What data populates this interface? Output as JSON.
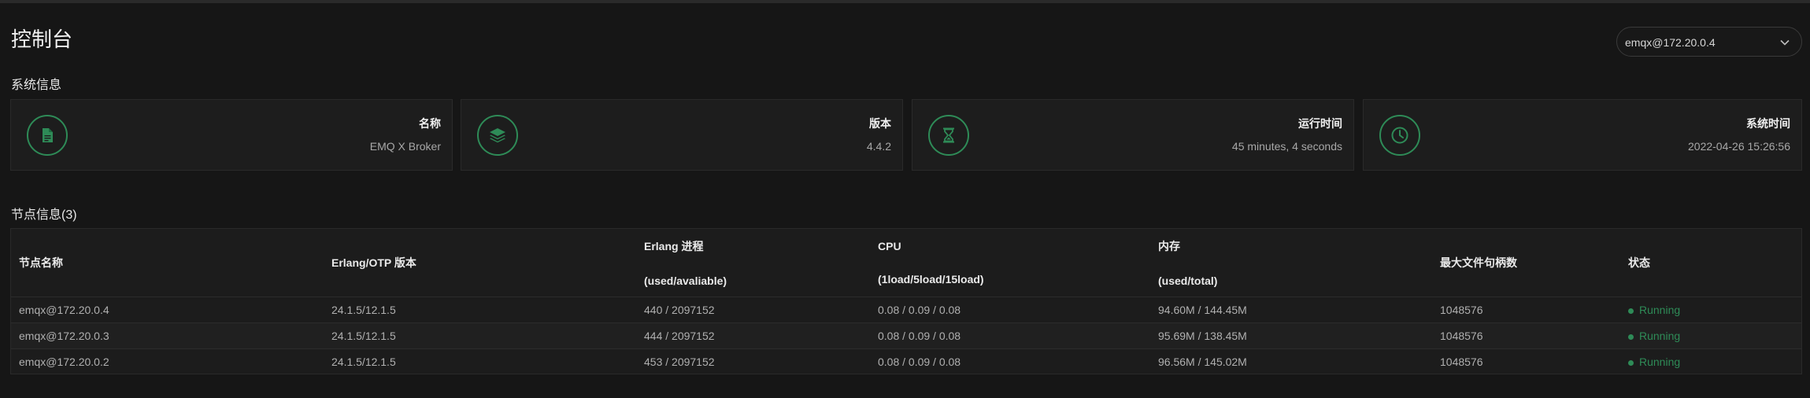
{
  "page": {
    "title": "控制台"
  },
  "node_selector": {
    "value": "emqx@172.20.0.4"
  },
  "system_info": {
    "heading": "系统信息",
    "cards": [
      {
        "label": "名称",
        "value": "EMQ X Broker",
        "icon": "file-icon"
      },
      {
        "label": "版本",
        "value": "4.4.2",
        "icon": "layers-icon"
      },
      {
        "label": "运行时间",
        "value": "45 minutes, 4 seconds",
        "icon": "hourglass-icon"
      },
      {
        "label": "系统时间",
        "value": "2022-04-26 15:26:56",
        "icon": "clock-icon"
      }
    ]
  },
  "nodes": {
    "heading": "节点信息(3)",
    "columns": [
      {
        "line1": "节点名称",
        "line2": ""
      },
      {
        "line1": "Erlang/OTP 版本",
        "line2": ""
      },
      {
        "line1": "Erlang 进程",
        "line2": "(used/avaliable)"
      },
      {
        "line1": "CPU",
        "line2": "(1load/5load/15load)"
      },
      {
        "line1": "内存",
        "line2": "(used/total)"
      },
      {
        "line1": "最大文件句柄数",
        "line2": ""
      },
      {
        "line1": "状态",
        "line2": ""
      }
    ],
    "rows": [
      {
        "name": "emqx@172.20.0.4",
        "otp": "24.1.5/12.1.5",
        "procs": "440 / 2097152",
        "cpu": "0.08 / 0.09 / 0.08",
        "mem": "94.60M / 144.45M",
        "fd": "1048576",
        "status": "Running"
      },
      {
        "name": "emqx@172.20.0.3",
        "otp": "24.1.5/12.1.5",
        "procs": "444 / 2097152",
        "cpu": "0.08 / 0.09 / 0.08",
        "mem": "95.69M / 138.45M",
        "fd": "1048576",
        "status": "Running"
      },
      {
        "name": "emqx@172.20.0.2",
        "otp": "24.1.5/12.1.5",
        "procs": "453 / 2097152",
        "cpu": "0.08 / 0.09 / 0.08",
        "mem": "96.56M / 145.02M",
        "fd": "1048576",
        "status": "Running"
      }
    ]
  },
  "colors": {
    "accent": "#2e8b57",
    "background": "#161616",
    "card": "#1d1d1d"
  }
}
